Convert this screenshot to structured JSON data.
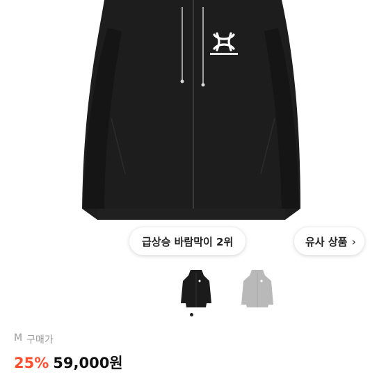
{
  "ranking_chip": {
    "label": "급상승 바람막이 2위"
  },
  "similar_chip": {
    "label": "유사 상품",
    "icon": "chevron-right-icon"
  },
  "thumbnails": [
    {
      "name": "black-jacket-thumbnail",
      "color": "#1b1b1b"
    },
    {
      "name": "gray-hoodie-thumbnail",
      "color": "#b9b9b9"
    }
  ],
  "pager": {
    "active_index": 0,
    "count": 2
  },
  "product": {
    "size": "M",
    "price_type": "구매가",
    "discount": "25%",
    "price": "59,000원"
  },
  "colors": {
    "discount": "#ff4d2d",
    "jacket": "#1b1b1b"
  }
}
